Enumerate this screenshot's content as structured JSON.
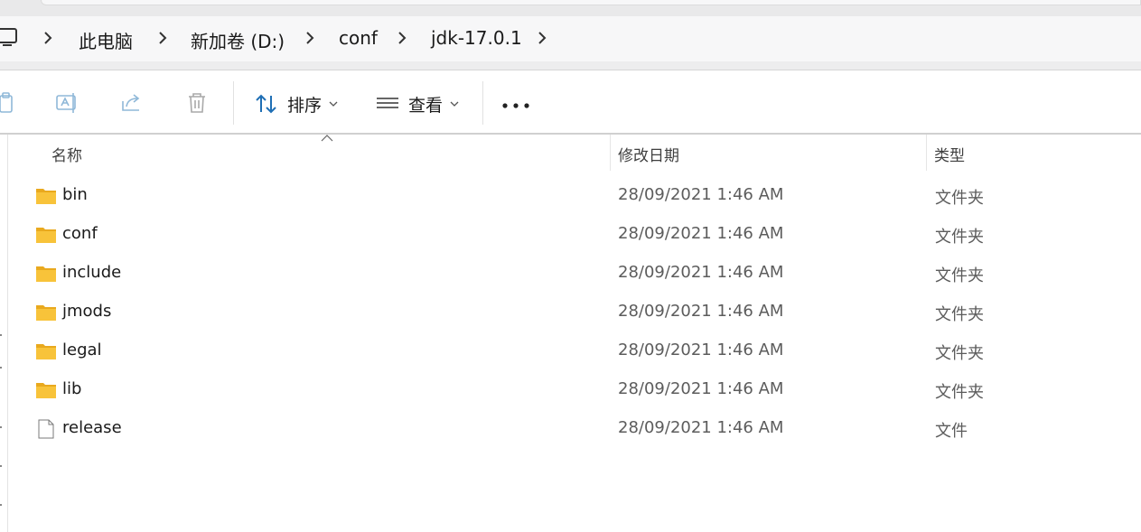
{
  "address_bar": {
    "breadcrumbs": [
      "此电脑",
      "新加卷 (D:)",
      "conf",
      "jdk-17.0.1"
    ]
  },
  "toolbar": {
    "sort_label": "排序",
    "view_label": "查看",
    "more_label": "•••"
  },
  "columns": {
    "name": "名称",
    "modified": "修改日期",
    "type": "类型"
  },
  "files": [
    {
      "name": "bin",
      "modified": "28/09/2021 1:46 AM",
      "type": "文件夹",
      "icon": "folder-icon"
    },
    {
      "name": "conf",
      "modified": "28/09/2021 1:46 AM",
      "type": "文件夹",
      "icon": "folder-icon"
    },
    {
      "name": "include",
      "modified": "28/09/2021 1:46 AM",
      "type": "文件夹",
      "icon": "folder-icon"
    },
    {
      "name": "jmods",
      "modified": "28/09/2021 1:46 AM",
      "type": "文件夹",
      "icon": "folder-icon"
    },
    {
      "name": "legal",
      "modified": "28/09/2021 1:46 AM",
      "type": "文件夹",
      "icon": "folder-icon"
    },
    {
      "name": "lib",
      "modified": "28/09/2021 1:46 AM",
      "type": "文件夹",
      "icon": "folder-icon"
    },
    {
      "name": "release",
      "modified": "28/09/2021 1:46 AM",
      "type": "文件",
      "icon": "file-icon"
    }
  ],
  "colors": {
    "folder_yellow": "#f8c33a",
    "folder_tab": "#e9a91e",
    "address_bg": "#f7f7f8"
  }
}
